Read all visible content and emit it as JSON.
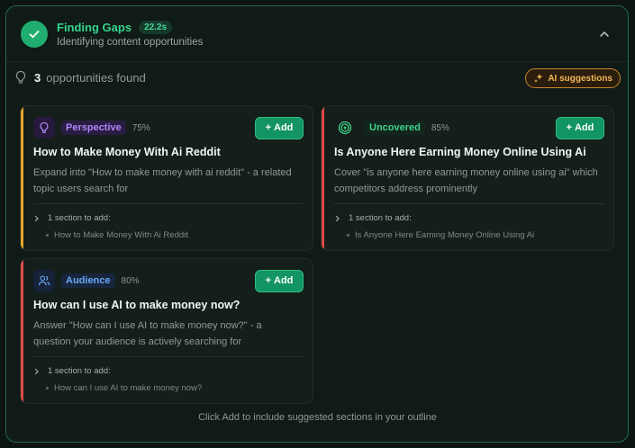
{
  "header": {
    "title": "Finding Gaps",
    "timer": "22.2s",
    "subtitle": "Identifying content opportunities"
  },
  "summary": {
    "count": "3",
    "label": "opportunities found",
    "ai_button_label": "AI suggestions"
  },
  "add_label": "Add",
  "cards": [
    {
      "tag": "Perspective",
      "percent": "75%",
      "title": "How to Make Money With Ai Reddit",
      "description": "Expand into \"How to make money with ai reddit\" - a related topic users search for",
      "section_header": "1 section to add:",
      "section_item": "How to Make Money With Ai Reddit",
      "accent": "#e8a52a",
      "icon": "bulb-icon"
    },
    {
      "tag": "Uncovered",
      "percent": "85%",
      "title": "Is Anyone Here Earning Money Online Using Ai",
      "description": "Cover \"is anyone here earning money online using ai\" which competitors address prominently",
      "section_header": "1 section to add:",
      "section_item": "Is Anyone Here Earning Money Online Using Ai",
      "accent": "#e04848",
      "icon": "target-icon"
    },
    {
      "tag": "Audience",
      "percent": "80%",
      "title": "How can I use AI to make money now?",
      "description": "Answer \"How can I use AI to make money now?\" - a question your audience is actively searching for",
      "section_header": "1 section to add:",
      "section_item": "How can I use AI to make money now?",
      "accent": "#e04848",
      "icon": "users-icon"
    }
  ],
  "footer": "Click Add to include suggested sections in your outline",
  "colors": {
    "brand": "#1fae6f",
    "perspective": "#a77bf0",
    "uncovered": "#3cd28a",
    "audience": "#6aa8f5"
  }
}
